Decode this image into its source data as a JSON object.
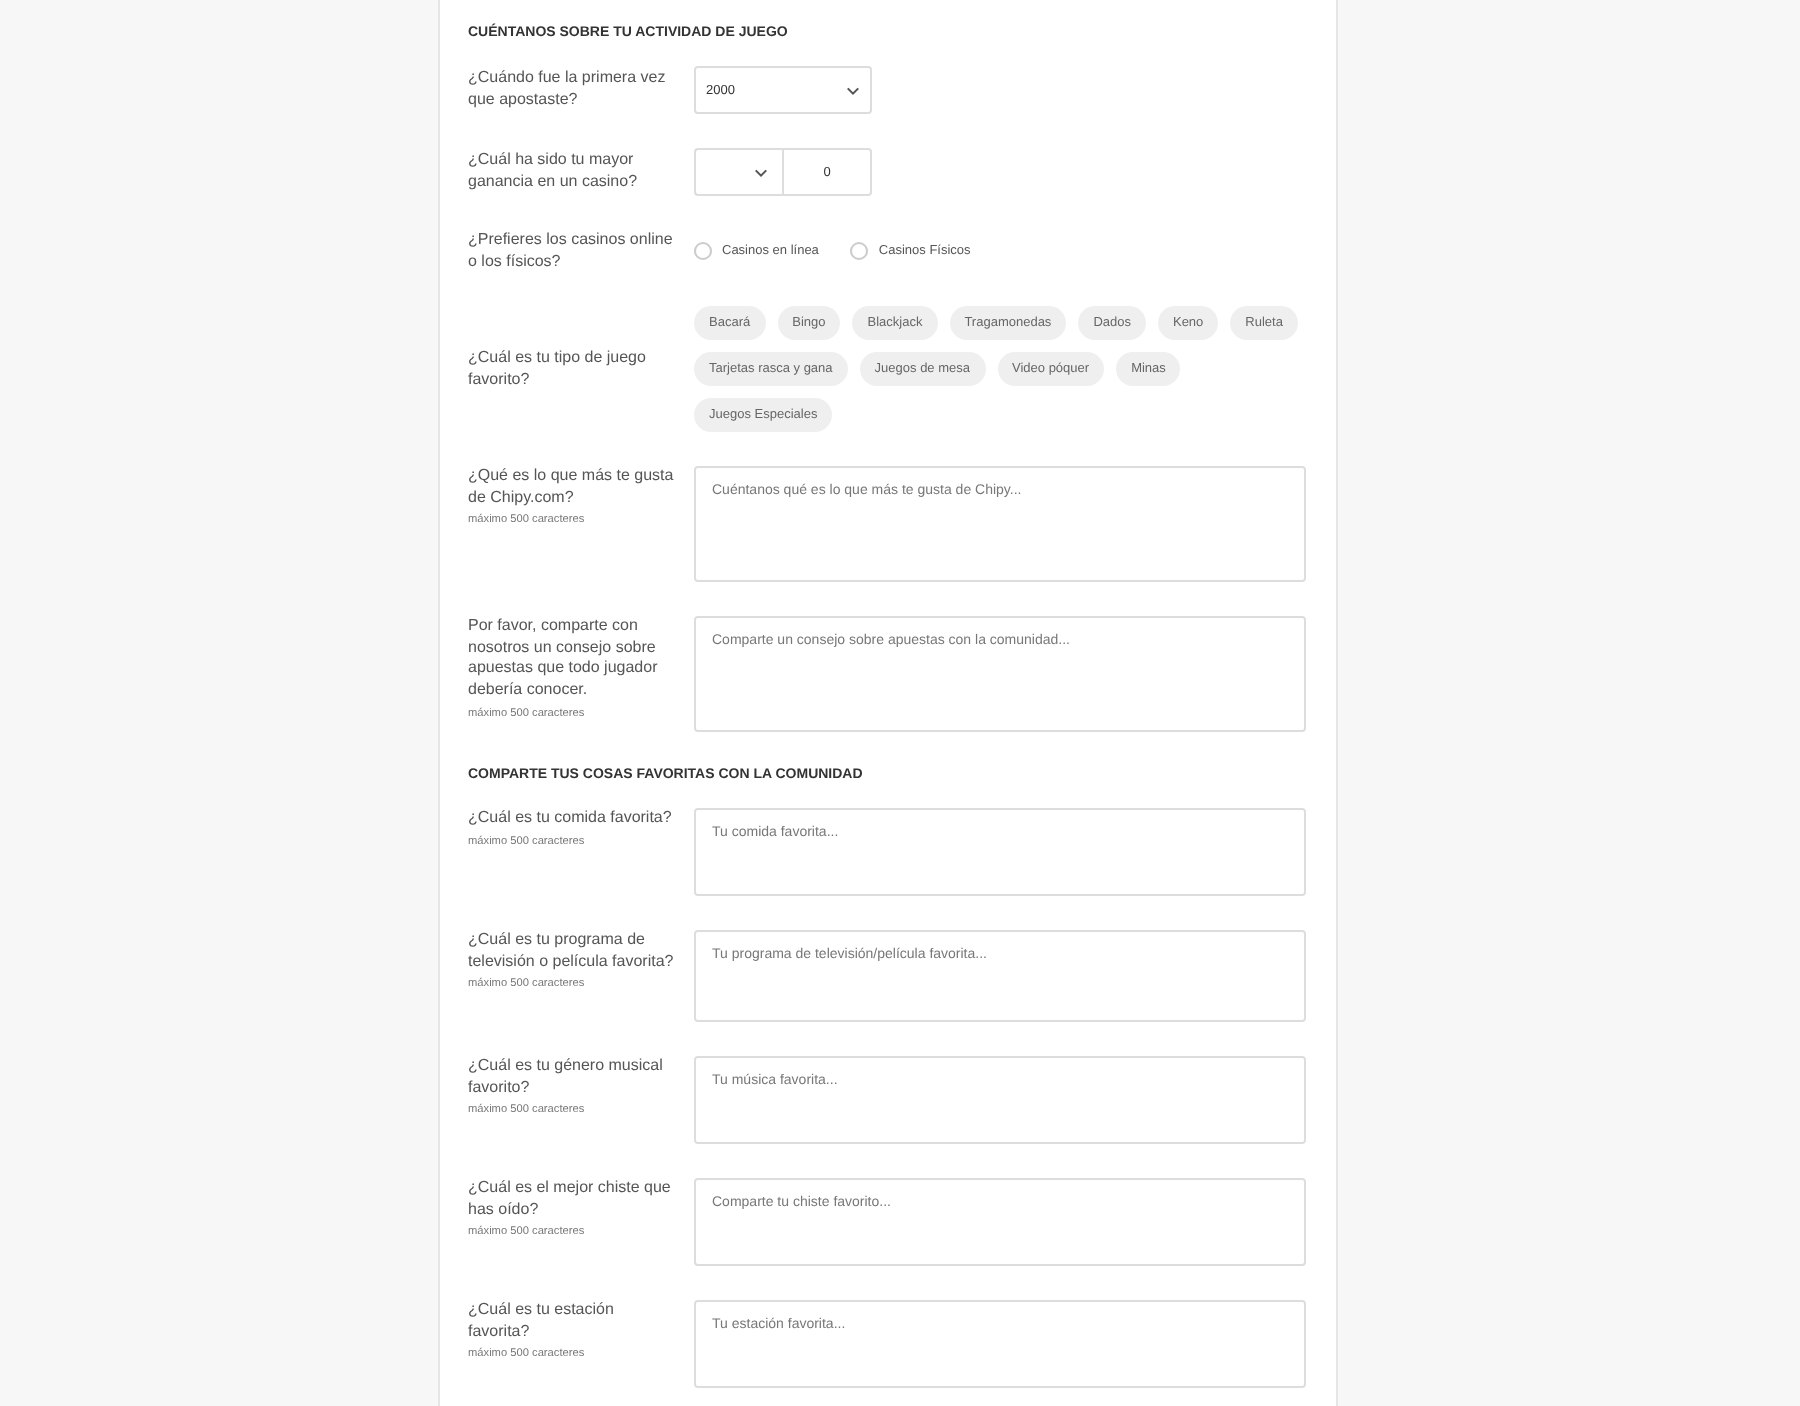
{
  "sections": [
    {
      "heading": "CUÉNTANOS SOBRE TU ACTIVIDAD DE JUEGO",
      "questions": [
        {
          "kind": "select",
          "label": "¿Cuándo fue la primera vez que apostaste?",
          "value": "2000"
        },
        {
          "kind": "currency",
          "label": "¿Cuál ha sido tu mayor ganancia en un casino?",
          "amount": "0"
        },
        {
          "kind": "radio",
          "label": "¿Prefieres los casinos online o los físicos?",
          "options": [
            {
              "label": "Casinos en línea",
              "selected": false
            },
            {
              "label": "Casinos Físicos",
              "selected": false
            }
          ]
        },
        {
          "kind": "chips",
          "label": "¿Cuál es tu tipo de juego favorito?",
          "options": [
            {
              "label": "Bacará",
              "selected": false
            },
            {
              "label": "Bingo",
              "selected": false
            },
            {
              "label": "Blackjack",
              "selected": false
            },
            {
              "label": "Tragamonedas",
              "selected": false
            },
            {
              "label": "Dados",
              "selected": false
            },
            {
              "label": "Keno",
              "selected": false
            },
            {
              "label": "Ruleta",
              "selected": false
            },
            {
              "label": "Tarjetas rasca y gana",
              "selected": false
            },
            {
              "label": "Juegos de mesa",
              "selected": false
            },
            {
              "label": "Video póquer",
              "selected": false
            },
            {
              "label": "Minas",
              "selected": false
            },
            {
              "label": "Juegos Especiales",
              "selected": false
            }
          ]
        },
        {
          "kind": "long-textarea",
          "label": "¿Qué es lo que más te gusta de Chipy.com?",
          "hint": "máximo 500 caracteres",
          "placeholder": "Cuéntanos qué es lo que más te gusta de Chipy..."
        },
        {
          "kind": "long-textarea",
          "label": "Por favor, comparte con nosotros un consejo sobre apuestas que todo jugador debería conocer.",
          "hint": "máximo 500 caracteres",
          "placeholder": "Comparte un consejo sobre apuestas con la comunidad..."
        }
      ]
    },
    {
      "heading": "COMPARTE TUS COSAS FAVORITAS CON LA COMUNIDAD",
      "questions": [
        {
          "kind": "textarea",
          "label": "¿Cuál es tu comida favorita?",
          "hint": "máximo 500 caracteres",
          "placeholder": "Tu comida favorita..."
        },
        {
          "kind": "textarea",
          "label": "¿Cuál es tu programa de televisión o película favorita?",
          "hint": "máximo 500 caracteres",
          "placeholder": "Tu programa de televisión/película favorita..."
        },
        {
          "kind": "textarea",
          "label": "¿Cuál es tu género musical favorito?",
          "hint": "máximo 500 caracteres",
          "placeholder": "Tu música favorita..."
        },
        {
          "kind": "textarea",
          "label": "¿Cuál es el mejor chiste que has oído?",
          "hint": "máximo 500 caracteres",
          "placeholder": "Comparte tu chiste favorito..."
        },
        {
          "kind": "textarea",
          "label": "¿Cuál es tu estación favorita?",
          "hint": "máximo 500 caracteres",
          "placeholder": "Tu estación favorita..."
        }
      ]
    }
  ]
}
